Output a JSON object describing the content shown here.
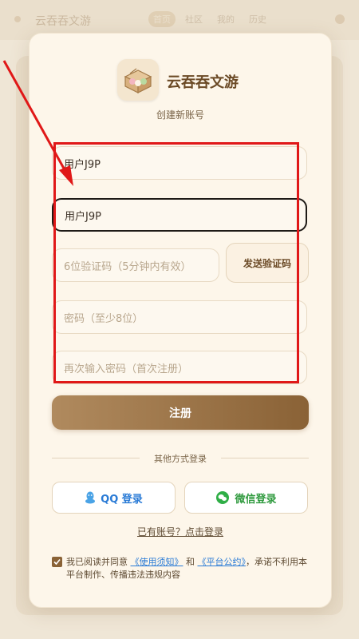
{
  "background_app": {
    "title": "云吞吞文游",
    "tabs": [
      "首页",
      "社区",
      "我的",
      "历史"
    ]
  },
  "modal": {
    "app_name": "云吞吞文游",
    "subtitle": "创建新账号",
    "username_value": "用户J9P",
    "nickname_value": "用户J9P",
    "code_placeholder": "6位验证码（5分钟内有效）",
    "send_code_label": "发送验证码",
    "password_placeholder": "密码（至少8位）",
    "confirm_placeholder": "再次输入密码（首次注册）",
    "register_label": "注册",
    "divider_text": "其他方式登录",
    "qq_label": "QQ 登录",
    "wechat_label": "微信登录",
    "login_link": "已有账号？点击登录",
    "agree_prefix": "我已阅读并同意",
    "terms_link": "《使用须知》",
    "and_text": "和",
    "convention_link": "《平台公约》",
    "agree_suffix": "，承诺不利用本平台制作、传播违法违规内容",
    "agreed": true
  },
  "colors": {
    "accent": "#8a6236",
    "annotation": "#e01818",
    "qq": "#2a7bd6",
    "wechat": "#2f9a3e"
  }
}
